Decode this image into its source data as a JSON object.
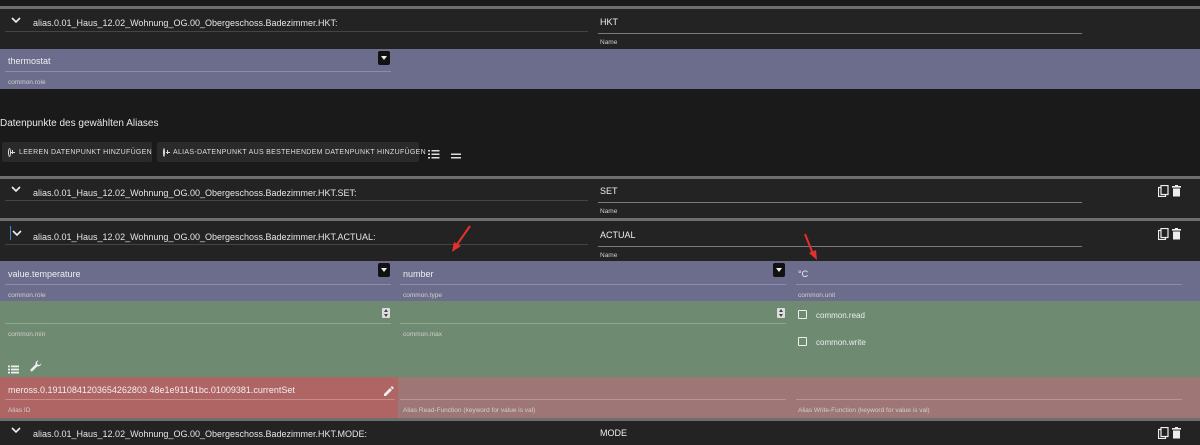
{
  "top_alias": {
    "id": "alias.0.01_Haus_12.02_Wohnung_OG.00_Obergeschoss.Badezimmer.HKT:",
    "name_value": "HKT",
    "name_label": "Name",
    "role_value": "thermostat",
    "role_label": "common.role"
  },
  "section_title": "Datenpunkte des gewählten Aliases",
  "toolbar": {
    "add_empty_label": "LEEREN DATENPUNKT HINZUFÜGEN",
    "add_existing_label": "ALIAS-DATENPUNKT AUS BESTEHENDEM DATENPUNKT HINZUFÜGEN"
  },
  "datapoints": [
    {
      "id": "alias.0.01_Haus_12.02_Wohnung_OG.00_Obergeschoss.Badezimmer.HKT.SET:",
      "name_value": "SET",
      "name_label": "Name"
    },
    {
      "id": "alias.0.01_Haus_12.02_Wohnung_OG.00_Obergeschoss.Badezimmer.HKT.ACTUAL:",
      "name_value": "ACTUAL",
      "name_label": "Name"
    },
    {
      "id": "alias.0.01_Haus_12.02_Wohnung_OG.00_Obergeschoss.Badezimmer.HKT.MODE:",
      "name_value": "MODE"
    }
  ],
  "actual_details": {
    "role_value": "value.temperature",
    "role_label": "common.role",
    "type_value": "number",
    "type_label": "common.type",
    "unit_value": "°C",
    "unit_label": "common.unit",
    "min_label": "common.min",
    "max_label": "common.max",
    "read_label": "common.read",
    "write_label": "common.write",
    "alias_id_value": "meross.0.19110841203654262803 48e1e91141bc.01009381.currentSet",
    "alias_id_label": "Alias ID",
    "read_fn_label": "Alias Read-Function (keyword for value is val)",
    "write_fn_label": "Alias Write-Function (keyword for value is val)"
  },
  "colors": {
    "role_row": "#6c6d8c",
    "common_row": "#6e8a70",
    "alias_row": "#b06565",
    "annotation_arrow": "#e53030"
  }
}
